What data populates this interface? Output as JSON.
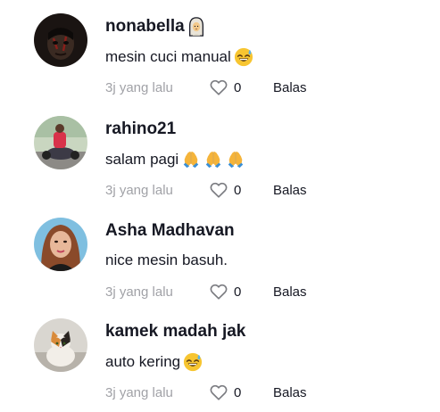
{
  "comments": [
    {
      "username": "nonabella",
      "username_emoji": "woman-headscarf-emoji",
      "text": "mesin cuci manual",
      "text_emojis": [
        "grinning-sweat-emoji"
      ],
      "time": "3j yang lalu",
      "likes": "0",
      "reply_label": "Balas"
    },
    {
      "username": "rahino21",
      "text": "salam pagi",
      "text_emojis": [
        "folded-hands-emoji",
        "folded-hands-emoji",
        "folded-hands-emoji"
      ],
      "time": "3j yang lalu",
      "likes": "0",
      "reply_label": "Balas"
    },
    {
      "username": "Asha Madhavan",
      "text": "nice mesin basuh.",
      "time": "3j yang lalu",
      "likes": "0",
      "reply_label": "Balas"
    },
    {
      "username": "kamek madah jak",
      "text": "auto kering",
      "text_emojis": [
        "grinning-sweat-emoji"
      ],
      "time": "3j yang lalu",
      "likes": "0",
      "reply_label": "Balas"
    }
  ],
  "colors": {
    "text_primary": "#161823",
    "text_secondary": "#a1a2a7",
    "background": "#ffffff"
  },
  "icons": {
    "like": "heart-outline-icon"
  }
}
